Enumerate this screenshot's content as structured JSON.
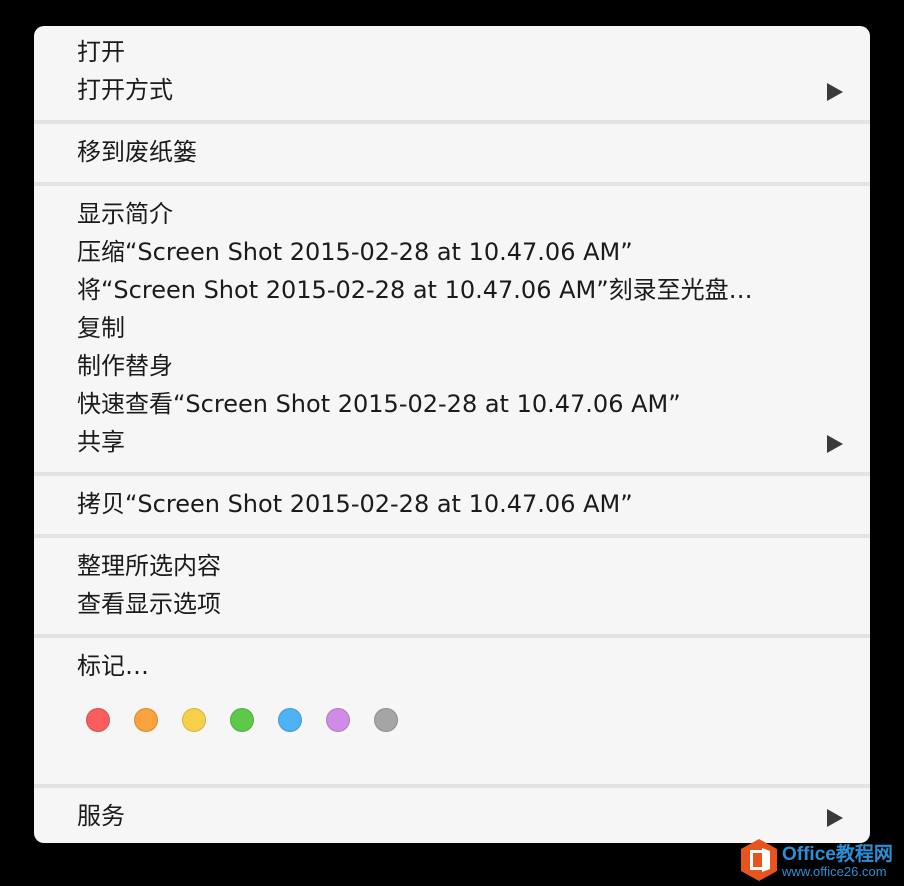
{
  "menu": {
    "open": "打开",
    "open_with": "打开方式",
    "move_to_trash": "移到废纸篓",
    "get_info": "显示简介",
    "compress": "压缩“Screen Shot 2015-02-28 at 10.47.06 AM”",
    "burn": "将“Screen Shot 2015-02-28 at 10.47.06 AM”刻录至光盘…",
    "duplicate": "复制",
    "make_alias": "制作替身",
    "quick_look": "快速查看“Screen Shot 2015-02-28 at 10.47.06 AM”",
    "share": "共享",
    "copy": "拷贝“Screen Shot 2015-02-28 at 10.47.06 AM”",
    "clean_up": "整理所选内容",
    "view_options": "查看显示选项",
    "tags": "标记…",
    "services": "服务"
  },
  "tag_colors": {
    "red": "#fb5c5c",
    "orange": "#f9a23e",
    "yellow": "#f7d04a",
    "green": "#5dc94b",
    "blue": "#4db3f4",
    "purple": "#cf8ce6",
    "gray": "#a5a5a5"
  },
  "submenu_icon": "triangle-right-icon",
  "watermark": {
    "title": "Office教程网",
    "url": "www.office26.com"
  }
}
